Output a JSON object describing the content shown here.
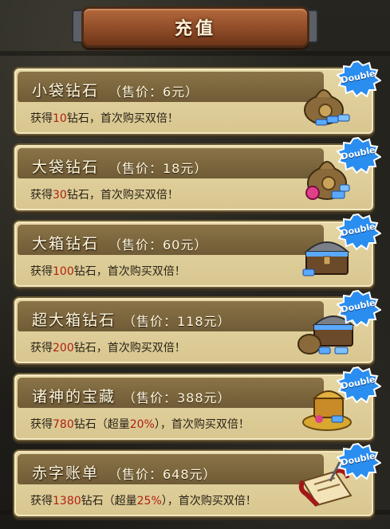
{
  "header": {
    "title": "充值"
  },
  "badge_label": "Double",
  "colors": {
    "accent_red": "#b01f12",
    "badge_blue": "#2a8df0",
    "card_bg": "#dccb93"
  },
  "items": [
    {
      "name": "小袋钻石",
      "price": "（售价：6元）",
      "desc_pre": "获得",
      "diamonds": "10",
      "desc_mid": "钻石",
      "bonus_pre": "",
      "bonus": "",
      "bonus_post": "",
      "desc_post": "，首次购买双倍！",
      "icon": "small-diamond-bag-icon"
    },
    {
      "name": "大袋钻石",
      "price": "（售价：18元）",
      "desc_pre": "获得",
      "diamonds": "30",
      "desc_mid": "钻石",
      "bonus_pre": "",
      "bonus": "",
      "bonus_post": "",
      "desc_post": "，首次购买双倍！",
      "icon": "big-diamond-bag-icon"
    },
    {
      "name": "大箱钻石",
      "price": "（售价：60元）",
      "desc_pre": "获得",
      "diamonds": "100",
      "desc_mid": "钻石",
      "bonus_pre": "",
      "bonus": "",
      "bonus_post": "",
      "desc_post": "，首次购买双倍！",
      "icon": "diamond-chest-icon"
    },
    {
      "name": "超大箱钻石",
      "price": "（售价：118元）",
      "desc_pre": "获得",
      "diamonds": "200",
      "desc_mid": "钻石",
      "bonus_pre": "",
      "bonus": "",
      "bonus_post": "",
      "desc_post": "，首次购买双倍！",
      "icon": "huge-diamond-chest-icon"
    },
    {
      "name": "诸神的宝藏",
      "price": "（售价：388元）",
      "desc_pre": "获得",
      "diamonds": "780",
      "desc_mid": "钻石",
      "bonus_pre": "（超量",
      "bonus": "20%",
      "bonus_post": "）",
      "desc_post": "，首次购买双倍！",
      "icon": "treasure-pile-icon"
    },
    {
      "name": "赤字账单",
      "price": "（售价：648元）",
      "desc_pre": "获得",
      "diamonds": "1380",
      "desc_mid": "钻石",
      "bonus_pre": "（超量",
      "bonus": "25%",
      "bonus_post": "）",
      "desc_post": "，首次购买双倍！",
      "icon": "scroll-bill-icon"
    }
  ]
}
